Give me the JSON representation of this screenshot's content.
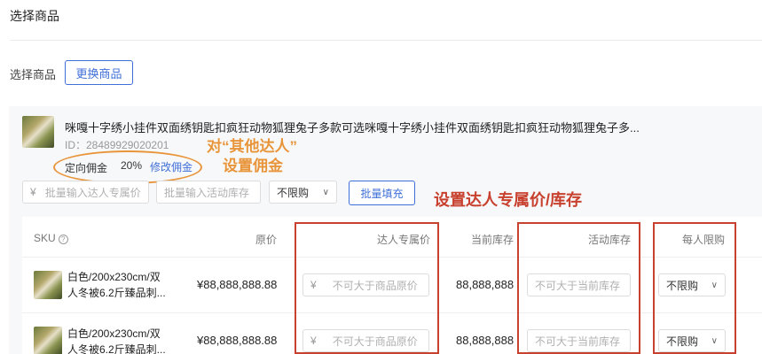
{
  "section_title": "选择商品",
  "select_label": "选择商品",
  "change_button": "更换商品",
  "product": {
    "title": "咪嘎十字绣小挂件双面绣钥匙扣疯狂动物狐狸兔子多款可选咪嘎十字绣小挂件双面绣钥匙扣疯狂动物狐狸兔子多...",
    "id": "ID：28489929020201",
    "commission_label": "定向佣金",
    "commission_rate": "20%",
    "commission_edit": "修改佣金"
  },
  "annotations": {
    "orange_line1": "对“其他达人”",
    "orange_line2": "设置佣金",
    "red": "设置达人专属价/库存"
  },
  "batch": {
    "price_symbol": "¥",
    "price_placeholder": "批量输入达人专属价",
    "stock_placeholder": "批量输入活动库存",
    "limit_value": "不限购",
    "fill_button": "批量填充"
  },
  "table": {
    "headers": {
      "sku": "SKU",
      "price": "原价",
      "exclusive_price": "达人专属价",
      "current_stock": "当前库存",
      "activity_stock": "活动库存",
      "limit": "每人限购"
    },
    "rows": [
      {
        "sku_line1": "白色/200x230cm/双",
        "sku_line2": "人冬被6.2斤臻品刺...",
        "price": "¥88,888,888.88",
        "price_symbol": "¥",
        "price_placeholder": "不可大于商品原价",
        "stock": "88,888,888",
        "stock_placeholder": "不可大于当前库存",
        "limit": "不限购"
      },
      {
        "sku_line1": "白色/200x230cm/双",
        "sku_line2": "人冬被6.2斤臻品刺...",
        "price": "¥88,888,888.88",
        "price_symbol": "¥",
        "price_placeholder": "不可大于商品原价",
        "stock": "88,888,888",
        "stock_placeholder": "不可大于当前库存",
        "limit": "不限购"
      }
    ]
  },
  "colors": {
    "primary": "#3f6fd8",
    "annotation_orange": "#e8953a",
    "annotation_red": "#c8402e"
  }
}
